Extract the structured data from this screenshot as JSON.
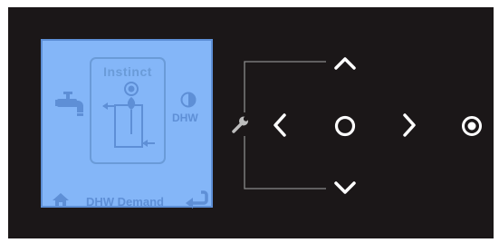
{
  "screen": {
    "appliance_name": "Instinct",
    "mode_label": "DHW",
    "status_label": "DHW Demand"
  },
  "icons": {
    "tap": "faucet-icon",
    "mode": "half-circle-icon",
    "home": "home-icon",
    "back": "return-arrow-icon",
    "settings": "wrench-icon",
    "up": "chevron-up-icon",
    "down": "chevron-down-icon",
    "left": "chevron-left-icon",
    "right": "chevron-right-icon",
    "select": "circle-select-icon",
    "power": "target-icon"
  },
  "colors": {
    "panel": "#1b1718",
    "screen": "#84b6f8",
    "screen_ink": "#5e8fd6",
    "controls": "#ffffff",
    "lines": "#8a8a8a"
  }
}
